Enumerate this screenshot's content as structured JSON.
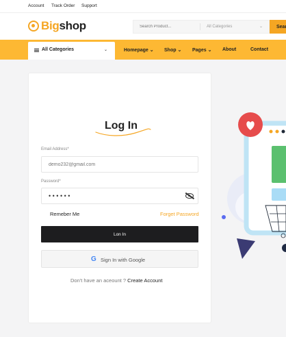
{
  "topbar": {
    "links": [
      "Account",
      "Track Order",
      "Support"
    ]
  },
  "header": {
    "logo_prefix": "Big",
    "logo_suffix": "shop",
    "search_placeholder": "Search Product...",
    "category_select": "All Categories",
    "search_button": "Sear"
  },
  "nav": {
    "all_categories": "All Categories",
    "links": [
      "Homepage",
      "Shop",
      "Pages",
      "About",
      "Contact"
    ]
  },
  "login": {
    "title": "Log In",
    "email_label": "Email Address*",
    "email_placeholder": "demo232@gmail.com",
    "password_label": "Password*",
    "password_masked": "••••••",
    "remember": "Remeber Me",
    "forgot": "Forget Password",
    "submit": "Lon In",
    "google": "Sign In with Google",
    "no_account": "Don't have an aceount ?",
    "create": "Create Account"
  },
  "colors": {
    "accent": "#f5a623",
    "nav_bg": "#fdb833",
    "dark_button": "#1d1d1f"
  }
}
